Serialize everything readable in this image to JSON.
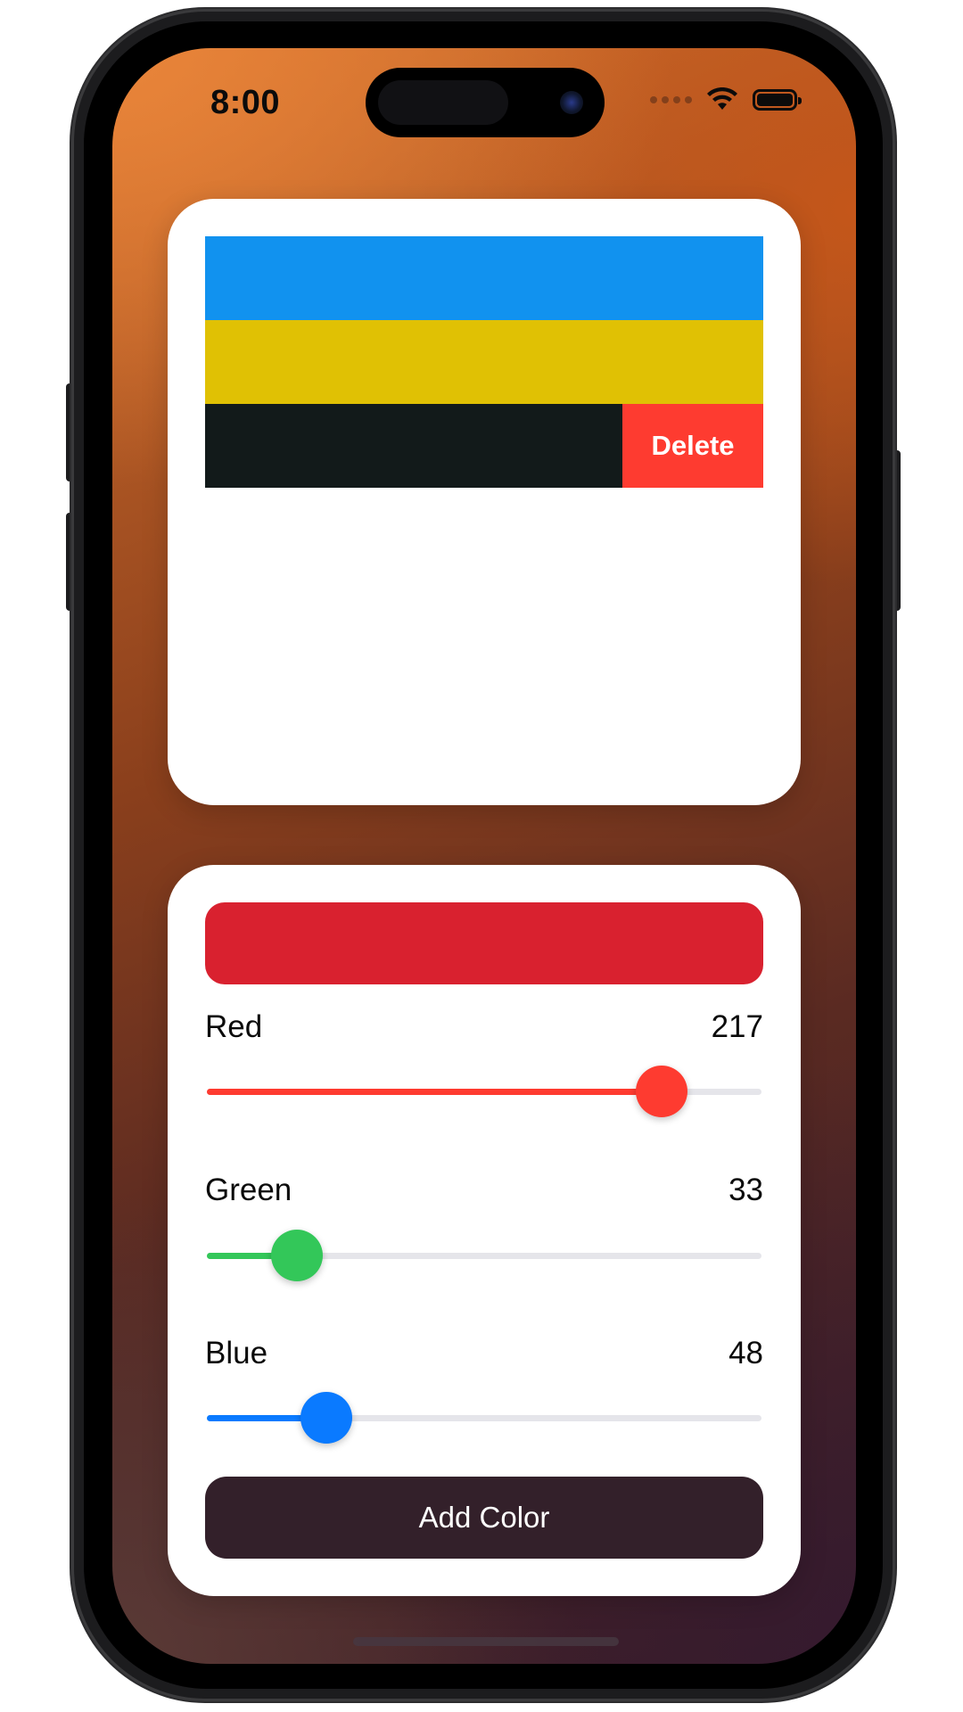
{
  "status_bar": {
    "time": "8:00",
    "icons": [
      "cellular-dots-icon",
      "wifi-icon",
      "battery-icon"
    ]
  },
  "color_list": {
    "rows": [
      {
        "color": "#1192ef"
      },
      {
        "color": "#e0c104"
      },
      {
        "color": "#121a1a"
      }
    ],
    "delete_action": {
      "label": "Delete",
      "color": "#fe3b30"
    }
  },
  "editor": {
    "preview_color": "#d9212f",
    "sliders": [
      {
        "label": "Red",
        "value": "217",
        "level": 217,
        "max": 255,
        "tint": "#fe3b30"
      },
      {
        "label": "Green",
        "value": "33",
        "level": 33,
        "max": 255,
        "tint": "#33c759"
      },
      {
        "label": "Blue",
        "value": "48",
        "level": 48,
        "max": 255,
        "tint": "#0a7aff"
      }
    ],
    "add_button": {
      "label": "Add Color",
      "color": "#33202a"
    }
  }
}
